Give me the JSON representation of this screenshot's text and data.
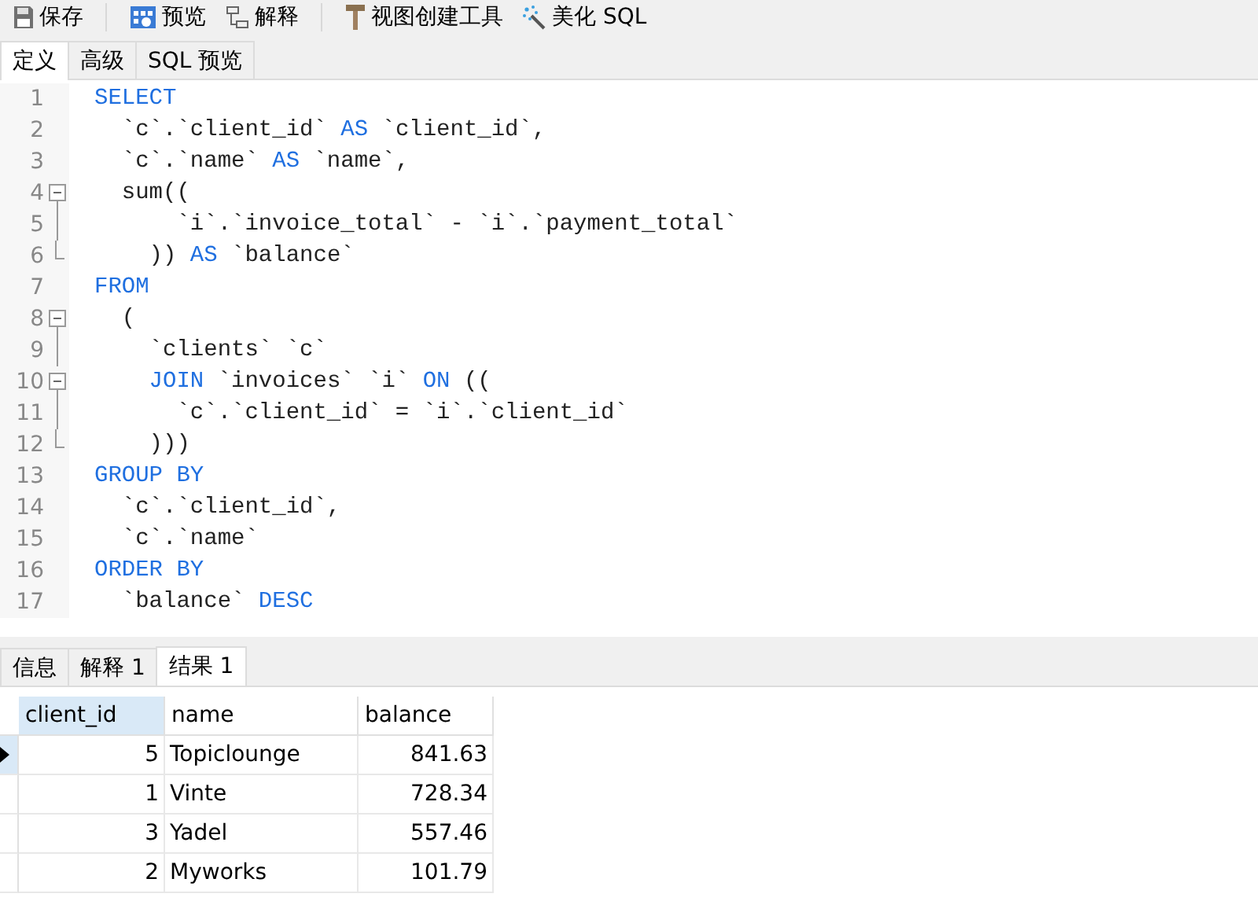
{
  "toolbar": [
    {
      "kind": "save",
      "label": "保存"
    },
    {
      "kind": "sep"
    },
    {
      "kind": "preview",
      "label": "预览"
    },
    {
      "kind": "explain",
      "label": "解释"
    },
    {
      "kind": "sep"
    },
    {
      "kind": "builder",
      "label": "视图创建工具"
    },
    {
      "kind": "beautify",
      "label": "美化 SQL"
    }
  ],
  "tabs": [
    {
      "label": "定义",
      "selected": true
    },
    {
      "label": "高级",
      "selected": false
    },
    {
      "label": "SQL 预览",
      "selected": false
    }
  ],
  "editor": {
    "lines": [
      {
        "number": "1",
        "tokens": [
          {
            "kind": "keyword",
            "text": "SELECT"
          }
        ]
      },
      {
        "number": "2",
        "tokens": [
          {
            "kind": "plain",
            "text": "  `c`.`client_id` "
          },
          {
            "kind": "keyword",
            "text": "AS"
          },
          {
            "kind": "plain",
            "text": " `client_id`,"
          }
        ]
      },
      {
        "number": "3",
        "tokens": [
          {
            "kind": "plain",
            "text": "  `c`.`name` "
          },
          {
            "kind": "keyword",
            "text": "AS"
          },
          {
            "kind": "plain",
            "text": " `name`,"
          }
        ]
      },
      {
        "number": "4",
        "kind": "fold_start",
        "expanded": true,
        "tokens": [
          {
            "kind": "plain",
            "text": "  sum(("
          }
        ]
      },
      {
        "number": "5",
        "kind": "fold_body",
        "tokens": [
          {
            "kind": "plain",
            "text": "      `i`.`invoice_total` - `i`.`payment_total`"
          }
        ]
      },
      {
        "number": "6",
        "kind": "fold_end",
        "tokens": [
          {
            "kind": "plain",
            "text": "    )) "
          },
          {
            "kind": "keyword",
            "text": "AS"
          },
          {
            "kind": "plain",
            "text": " `balance`"
          }
        ]
      },
      {
        "number": "7",
        "tokens": [
          {
            "kind": "keyword",
            "text": "FROM"
          }
        ]
      },
      {
        "number": "8",
        "kind": "fold_start",
        "expanded": true,
        "tokens": [
          {
            "kind": "plain",
            "text": "  ("
          }
        ]
      },
      {
        "number": "9",
        "kind": "fold_body",
        "tokens": [
          {
            "kind": "plain",
            "text": "    `clients` `c`"
          }
        ]
      },
      {
        "number": "10",
        "kind": "fold_start",
        "expanded": true,
        "tokens": [
          {
            "kind": "keyword",
            "text": "    JOIN"
          },
          {
            "kind": "plain",
            "text": " `invoices` `i` "
          },
          {
            "kind": "keyword",
            "text": "ON"
          },
          {
            "kind": "plain",
            "text": " (("
          }
        ]
      },
      {
        "number": "11",
        "kind": "fold_body",
        "tokens": [
          {
            "kind": "plain",
            "text": "      `c`.`client_id` = `i`.`client_id`"
          }
        ]
      },
      {
        "number": "12",
        "kind": "fold_end",
        "tokens": [
          {
            "kind": "plain",
            "text": "    )))"
          }
        ]
      },
      {
        "number": "13",
        "tokens": [
          {
            "kind": "keyword",
            "text": "GROUP BY"
          }
        ]
      },
      {
        "number": "14",
        "tokens": [
          {
            "kind": "plain",
            "text": "  `c`.`client_id`,"
          }
        ]
      },
      {
        "number": "15",
        "tokens": [
          {
            "kind": "plain",
            "text": "  `c`.`name`"
          }
        ]
      },
      {
        "number": "16",
        "tokens": [
          {
            "kind": "keyword",
            "text": "ORDER BY"
          }
        ]
      },
      {
        "number": "17",
        "tokens": [
          {
            "kind": "plain",
            "text": "  `balance` "
          },
          {
            "kind": "keyword",
            "text": "DESC"
          }
        ]
      }
    ]
  },
  "result_tabs": [
    {
      "label": "信息",
      "selected": false
    },
    {
      "label": "解释 1",
      "selected": false
    },
    {
      "label": "结果 1",
      "selected": true
    }
  ],
  "table": {
    "columns": [
      {
        "label": "client_id",
        "selected": true
      },
      {
        "label": "name",
        "selected": false
      },
      {
        "label": "balance",
        "selected": false
      }
    ],
    "rows": [
      {
        "selected": true,
        "cells": [
          "5",
          "Topiclounge",
          "841.63"
        ]
      },
      {
        "selected": false,
        "cells": [
          "1",
          "Vinte",
          "728.34"
        ]
      },
      {
        "selected": false,
        "cells": [
          "3",
          "Yadel",
          "557.46"
        ]
      },
      {
        "selected": false,
        "cells": [
          "2",
          "Myworks",
          "101.79"
        ]
      }
    ]
  }
}
